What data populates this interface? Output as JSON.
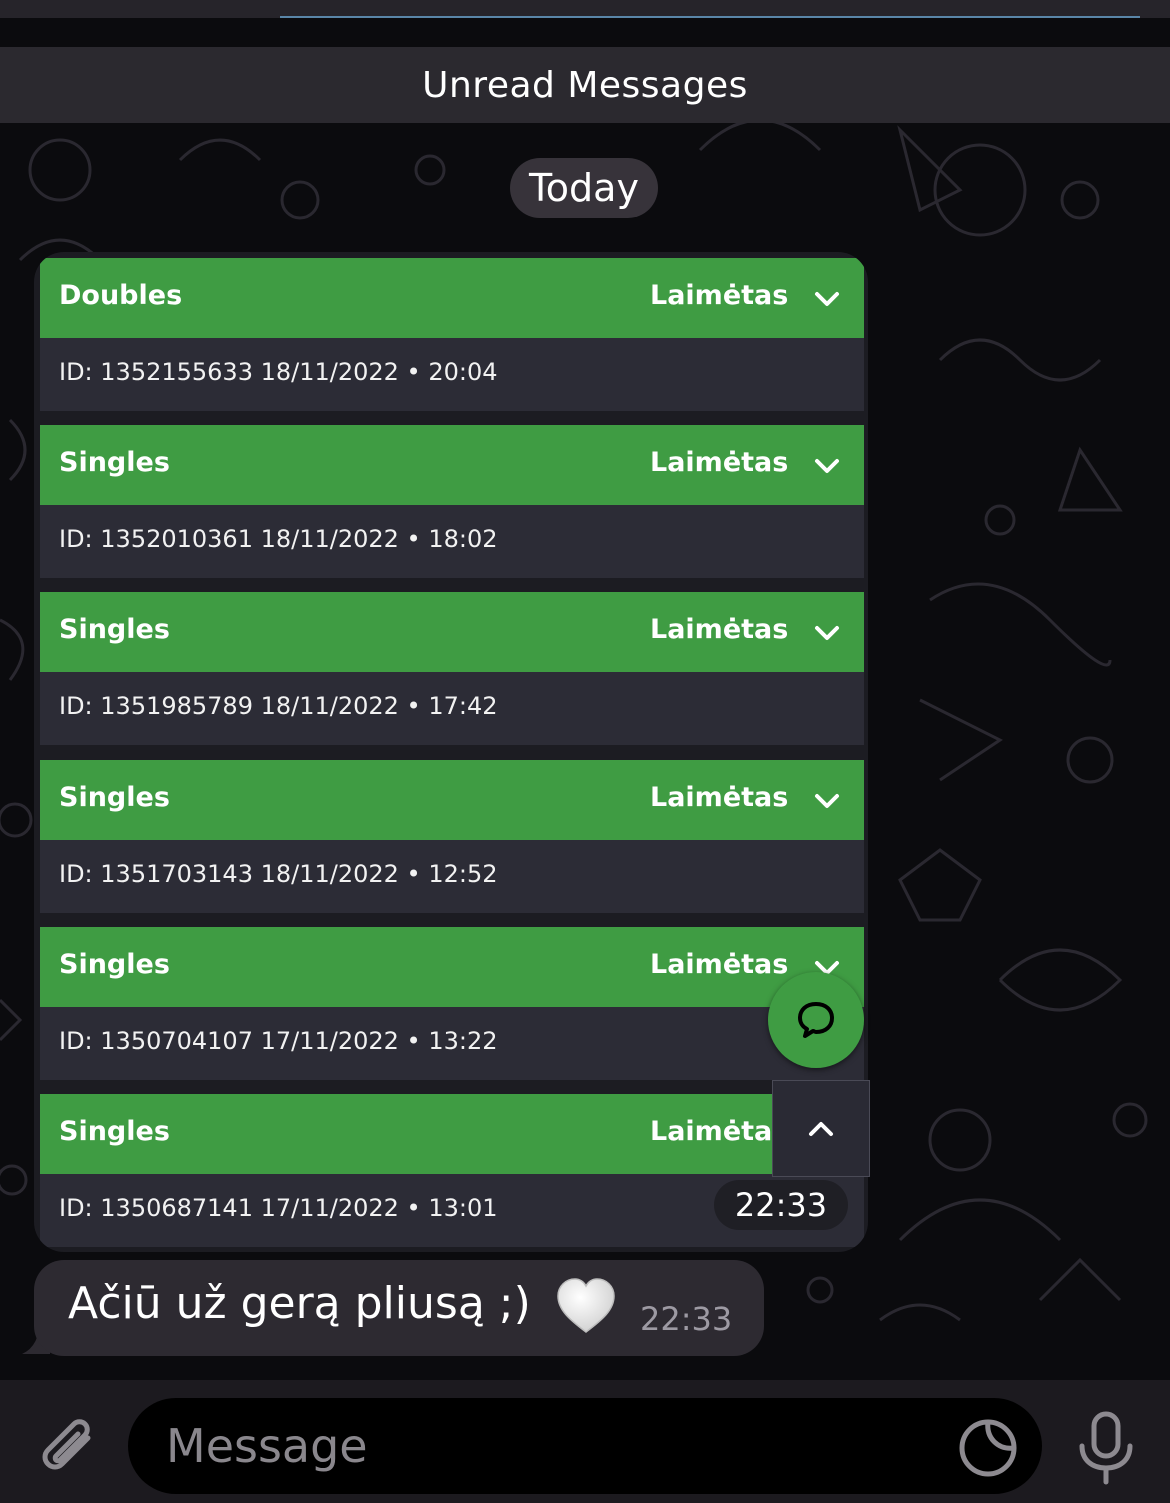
{
  "header": {
    "unread_label": "Unread Messages"
  },
  "chat": {
    "date_separator": "Today"
  },
  "bets_message": {
    "bets": [
      {
        "type": "Doubles",
        "status": "Laimėtas",
        "id_line": "ID: 1352155633  18/11/2022 • 20:04"
      },
      {
        "type": "Singles",
        "status": "Laimėtas",
        "id_line": "ID: 1352010361  18/11/2022 • 18:02"
      },
      {
        "type": "Singles",
        "status": "Laimėtas",
        "id_line": "ID: 1351985789  18/11/2022 • 17:42"
      },
      {
        "type": "Singles",
        "status": "Laimėtas",
        "id_line": "ID: 1351703143  18/11/2022 • 12:52"
      },
      {
        "type": "Singles",
        "status": "Laimėtas",
        "id_line": "ID: 1350704107  17/11/2022 • 13:22"
      },
      {
        "type": "Singles",
        "status": "Laimėtas",
        "id_line": "ID: 1350687141  17/11/2022 • 13:01"
      }
    ],
    "time": "22:33"
  },
  "text_message": {
    "text": "Ačiū už gerą pliusą ;)",
    "emoji": "white-heart",
    "time": "22:33"
  },
  "composer": {
    "placeholder": "Message"
  },
  "icons": {
    "attach": "paperclip-icon",
    "sticker": "sticker-icon",
    "mic": "microphone-icon",
    "chat_fab": "chat-bubble-icon",
    "scroll_up": "chevron-up-icon",
    "expand": "chevron-down-icon"
  },
  "colors": {
    "accent_green": "#3f9c43",
    "bubble_dark": "#2d2a31",
    "card_body": "#2c2c36"
  }
}
